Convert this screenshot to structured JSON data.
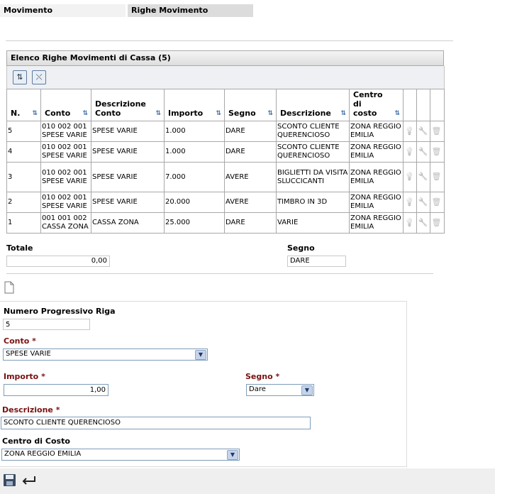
{
  "tabs": [
    {
      "label": "Movimento"
    },
    {
      "label": "Righe Movimento"
    }
  ],
  "panel": {
    "title": "Elenco Righe Movimenti di Cassa (5)",
    "toolbar": {
      "sort_icon": "sort-arrows-icon",
      "clear_sort_icon": "clear-sort-icon"
    }
  },
  "table": {
    "headers": [
      "N.",
      "Conto",
      "Descrizione Conto",
      "Importo",
      "Segno",
      "Descrizione",
      "Centro di costo"
    ],
    "rows": [
      {
        "n": "5",
        "conto": "010 002 001 SPESE VARIE",
        "desc_conto": "SPESE VARIE",
        "importo": "1.000",
        "segno": "DARE",
        "descrizione": "SCONTO CLIENTE QUERENCIOSO",
        "centro": "ZONA REGGIO EMILIA"
      },
      {
        "n": "4",
        "conto": "010 002 001 SPESE VARIE",
        "desc_conto": "SPESE VARIE",
        "importo": "1.000",
        "segno": "DARE",
        "descrizione": "SCONTO CLIENTE QUERENCIOSO",
        "centro": "ZONA REGGIO EMILIA"
      },
      {
        "n": "3",
        "conto": "010 002 001 SPESE VARIE",
        "desc_conto": "SPESE VARIE",
        "importo": "7.000",
        "segno": "AVERE",
        "descrizione": "BIGLIETTI DA VISITA SLUCCICANTI",
        "centro": "ZONA REGGIO EMILIA"
      },
      {
        "n": "2",
        "conto": "010 002 001 SPESE VARIE",
        "desc_conto": "SPESE VARIE",
        "importo": "20.000",
        "segno": "AVERE",
        "descrizione": "TIMBRO IN 3D",
        "centro": "ZONA REGGIO EMILIA"
      },
      {
        "n": "1",
        "conto": "001 001 002 CASSA ZONA",
        "desc_conto": "CASSA ZONA",
        "importo": "25.000",
        "segno": "DARE",
        "descrizione": "VARIE",
        "centro": "ZONA REGGIO EMILIA"
      }
    ],
    "row_icons": [
      "lightbulb-icon",
      "wrench-icon",
      "trash-icon"
    ]
  },
  "totals": {
    "totale_label": "Totale",
    "totale_value": "0,00",
    "segno_label": "Segno",
    "segno_value": "DARE"
  },
  "form": {
    "new_icon": "new-document-icon",
    "numero_label": "Numero Progressivo Riga",
    "numero_value": "5",
    "conto_label": "Conto",
    "conto_value": "SPESE VARIE",
    "importo_label": "Importo",
    "importo_value": "1,00",
    "segno_label": "Segno",
    "segno_value": "Dare",
    "descrizione_label": "Descrizione",
    "descrizione_value": "SCONTO CLIENTE QUERENCIOSO",
    "centro_label": "Centro di Costo",
    "centro_value": "ZONA REGGIO EMILIA",
    "required_mark": "*"
  },
  "bottombar": {
    "save_icon": "floppy-disk-icon",
    "back_icon": "return-arrow-icon"
  }
}
